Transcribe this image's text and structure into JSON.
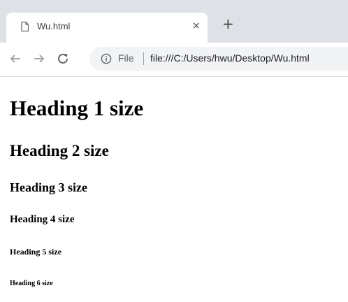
{
  "browser": {
    "tab": {
      "title": "Wu.html",
      "close_glyph": "×",
      "icon": "document-icon"
    },
    "new_tab_glyph": "+",
    "toolbar": {
      "back_icon": "arrow-left-icon",
      "forward_icon": "arrow-right-icon",
      "reload_icon": "reload-icon"
    },
    "omnibox": {
      "info_icon": "info-icon",
      "scheme_label": "File",
      "url": "file:///C:/Users/hwu/Desktop/Wu.html"
    }
  },
  "page": {
    "headings": [
      "Heading 1 size",
      "Heading 2 size",
      "Heading 3 size",
      "Heading 4 size",
      "Heading 5 size",
      "Heading 6 size"
    ]
  },
  "colors": {
    "chrome_bg": "#dee1e6",
    "tab_bg": "#ffffff",
    "omnibox_bg": "#f1f3f4",
    "icon_color": "#5f6368",
    "text_color": "#000000"
  }
}
